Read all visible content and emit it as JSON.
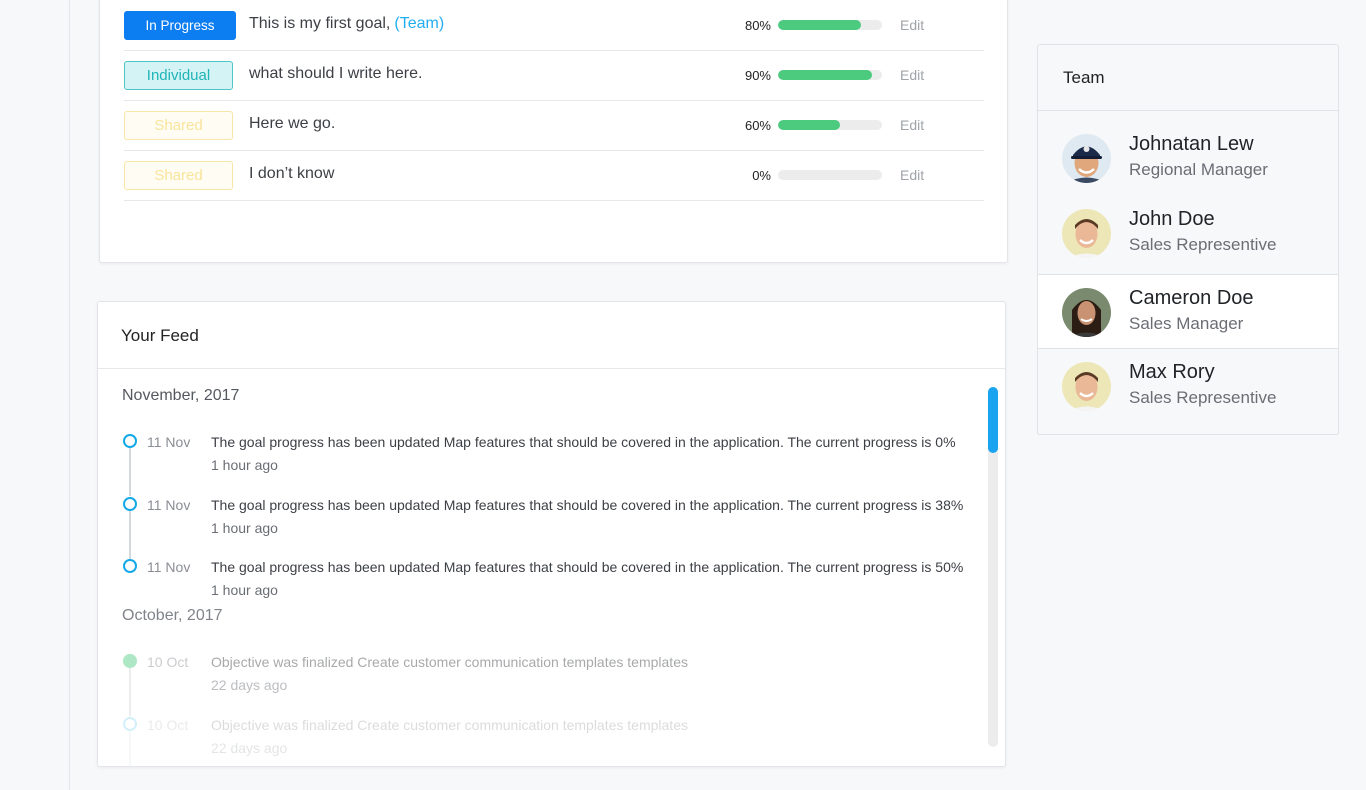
{
  "goals": [
    {
      "badge": "In Progress",
      "badge_type": "inprogress",
      "title": "This is my first goal,",
      "tag": "(Team)",
      "percent_label": "80%",
      "progress": 0.8,
      "edit_label": "Edit"
    },
    {
      "badge": "Individual",
      "badge_type": "individual",
      "title": "what should I write here.",
      "tag": "",
      "percent_label": "90%",
      "progress": 0.9,
      "edit_label": "Edit"
    },
    {
      "badge": "Shared",
      "badge_type": "shared",
      "title": "Here we go.",
      "tag": "",
      "percent_label": "60%",
      "progress": 0.6,
      "edit_label": "Edit"
    },
    {
      "badge": "Shared",
      "badge_type": "shared",
      "title": "I don’t know",
      "tag": "",
      "percent_label": "0%",
      "progress": 0.0,
      "edit_label": "Edit"
    }
  ],
  "feed": {
    "title": "Your Feed",
    "months": [
      {
        "label": "November, 2017",
        "items": [
          {
            "date": "11 Nov",
            "text": "The goal progress has been updated Map features that should be covered in the application. The current progress is 0%",
            "ago": "1 hour ago"
          },
          {
            "date": "11 Nov",
            "text": "The goal progress has been updated Map features that should be covered in the application. The current progress is 38%",
            "ago": "1 hour ago"
          },
          {
            "date": "11 Nov",
            "text": "The goal progress has been updated Map features that should be covered in the application. The current progress is 50%",
            "ago": "1 hour ago"
          }
        ]
      },
      {
        "label": "October, 2017",
        "items": [
          {
            "date": "10 Oct",
            "text": "Objective was finalized Create customer communication templates templates",
            "ago": "22 days ago"
          },
          {
            "date": "10 Oct",
            "text": "Objective was finalized Create customer communication templates templates",
            "ago": "22 days ago"
          }
        ]
      }
    ]
  },
  "team": {
    "title": "Team",
    "members": [
      {
        "name": "Johnatan Lew",
        "role": "Regional Manager"
      },
      {
        "name": "John Doe",
        "role": "Sales Representive"
      },
      {
        "name": "Cameron Doe",
        "role": "Sales Manager"
      },
      {
        "name": "Max Rory",
        "role": "Sales Representive"
      }
    ]
  },
  "colors": {
    "accent": "#0d7df2",
    "progress": "#4ccb7f",
    "link": "#22aef0",
    "timeline": "#12a9e6"
  }
}
